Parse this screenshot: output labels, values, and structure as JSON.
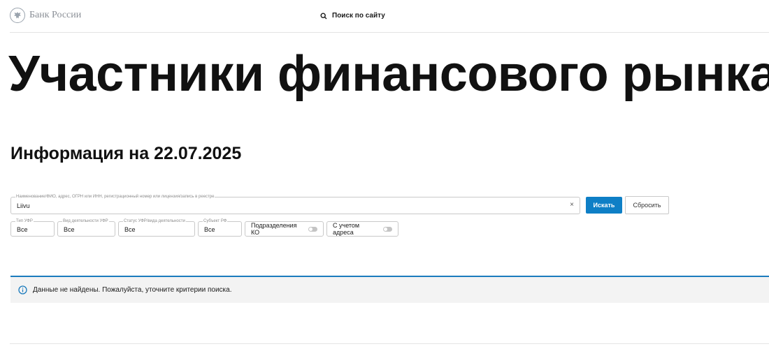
{
  "header": {
    "logo_text": "Банк России",
    "search_label": "Поиск по сайту"
  },
  "main": {
    "title": "Участники финансового рынка",
    "info_date": "Информация на 22.07.2025"
  },
  "search": {
    "legend": "Наименование/ФИО, адрес, ОГРН или ИНН, регистрационный номер или лицензия/запись в реестре",
    "value": "Liivu",
    "clear": "×",
    "submit_label": "Искать",
    "reset_label": "Сбросить"
  },
  "filters": {
    "type": {
      "legend": "Тип УФР",
      "value": "Все"
    },
    "activity": {
      "legend": "Вид деятельности УФР",
      "value": "Все"
    },
    "status": {
      "legend": "Статус УФР/вида деятельности",
      "value": "Все"
    },
    "region": {
      "legend": "Субъект РФ",
      "value": "Все"
    },
    "branches_toggle": "Подразделения КО",
    "address_toggle": "С учетом адреса"
  },
  "notice": {
    "text": "Данные не найдены. Пожалуйста, уточните критерии поиска.",
    "icon": "info-icon",
    "accent_color": "#1b7bbd"
  },
  "colors": {
    "primary_button": "#0e7fc6"
  }
}
